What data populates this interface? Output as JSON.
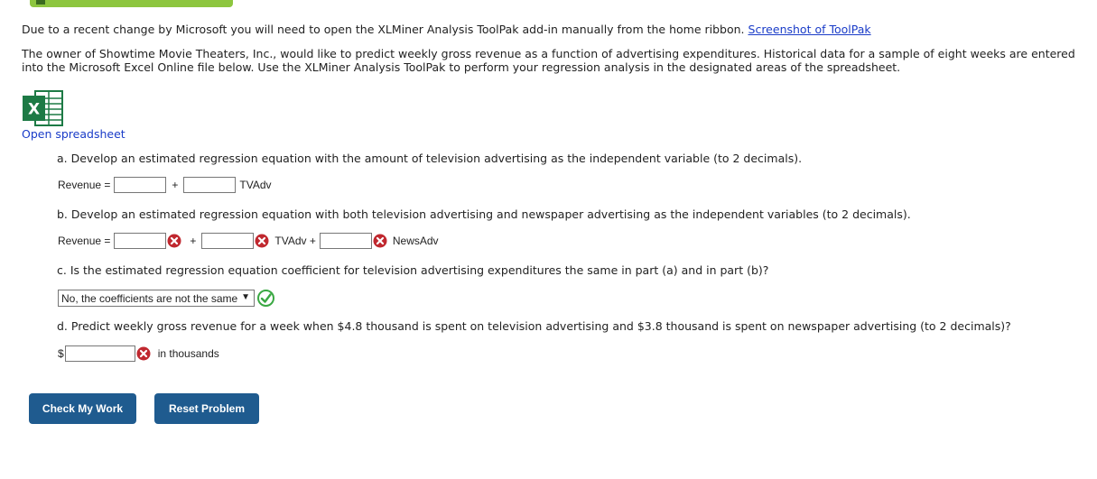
{
  "notice": {
    "text": "Due to a recent change by Microsoft you will need to open the XLMiner Analysis ToolPak add-in manually from the home ribbon.",
    "link": "Screenshot of ToolPak"
  },
  "intro": "The owner of Showtime Movie Theaters, Inc., would like to predict weekly gross revenue as a function of advertising expenditures. Historical data for a sample of eight weeks are entered into the Microsoft Excel Online file below. Use the XLMiner Analysis ToolPak to perform your regression analysis in the designated areas of the spreadsheet.",
  "spreadsheet": {
    "link": "Open spreadsheet",
    "icon": "excel-icon",
    "icon_letter": "X"
  },
  "part_a": {
    "question": "a. Develop an estimated regression equation with the amount of television advertising as the independent variable (to 2 decimals).",
    "label": "Revenue =",
    "plus": "+",
    "var1": "TVAdv",
    "input1": "",
    "input2": ""
  },
  "part_b": {
    "question": "b. Develop an estimated regression equation with both television advertising and newspaper advertising as the independent variables (to 2 decimals).",
    "label": "Revenue =",
    "plus": "+",
    "var1": "TVAdv +",
    "var2": "NewsAdv",
    "input1": "",
    "input2": "",
    "input3": "",
    "status": "incorrect"
  },
  "part_c": {
    "question": "c. Is the estimated regression equation coefficient for television advertising expenditures the same in part (a) and in part (b)?",
    "selected": "No, the coefficients are not the same",
    "status": "correct"
  },
  "part_d": {
    "question": "d. Predict weekly gross revenue for a week when $4.8 thousand is spent on television advertising and $3.8 thousand is spent on newspaper advertising (to 2 decimals)?",
    "prefix": "$",
    "suffix": "in thousands",
    "input": "",
    "status": "incorrect"
  },
  "buttons": {
    "check": "Check My Work",
    "reset": "Reset Problem"
  },
  "colors": {
    "button": "#1f5b8f",
    "link": "#1a3cc8",
    "incorrect": "#c0282f",
    "correct": "#3aa843",
    "excel": "#1d7a45"
  }
}
